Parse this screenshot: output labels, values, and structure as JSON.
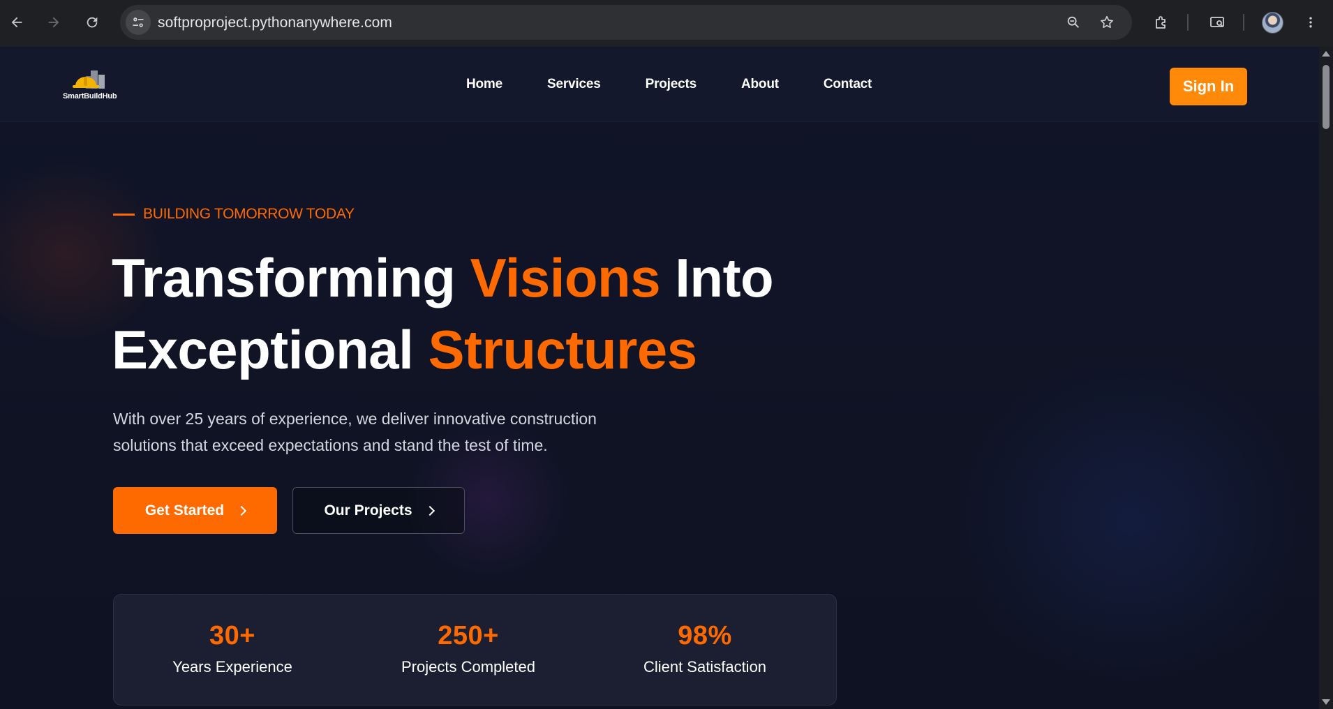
{
  "browser": {
    "url": "softproproject.pythonanywhere.com",
    "icons": [
      "back-arrow-icon",
      "forward-arrow-icon",
      "reload-icon",
      "site-info-icon",
      "zoom-icon",
      "bookmark-star-icon",
      "extensions-icon",
      "cast-search-icon",
      "profile-avatar",
      "kebab-menu-icon"
    ]
  },
  "site": {
    "logo_text": "SmartBuildHub",
    "nav": [
      "Home",
      "Services",
      "Projects",
      "About",
      "Contact"
    ],
    "signin_label": "Sign In"
  },
  "hero": {
    "eyebrow": "BUILDING TOMORROW TODAY",
    "headline": {
      "part1": "Transforming ",
      "accent1": "Visions",
      "part2": " Into",
      "part3": "Exceptional ",
      "accent2": "Structures"
    },
    "subtext_line1": "With over 25 years of experience, we deliver innovative construction",
    "subtext_line2": "solutions that exceed expectations and stand the test of time.",
    "primary_cta": "Get Started",
    "secondary_cta": "Our Projects"
  },
  "stats": [
    {
      "value": "30+",
      "label": "Years Experience"
    },
    {
      "value": "250+",
      "label": "Projects Completed"
    },
    {
      "value": "98%",
      "label": "Client Satisfaction"
    }
  ],
  "colors": {
    "accent": "#ff6a00",
    "signin_bg": "#ff8a0a",
    "background": "#0f1220"
  }
}
